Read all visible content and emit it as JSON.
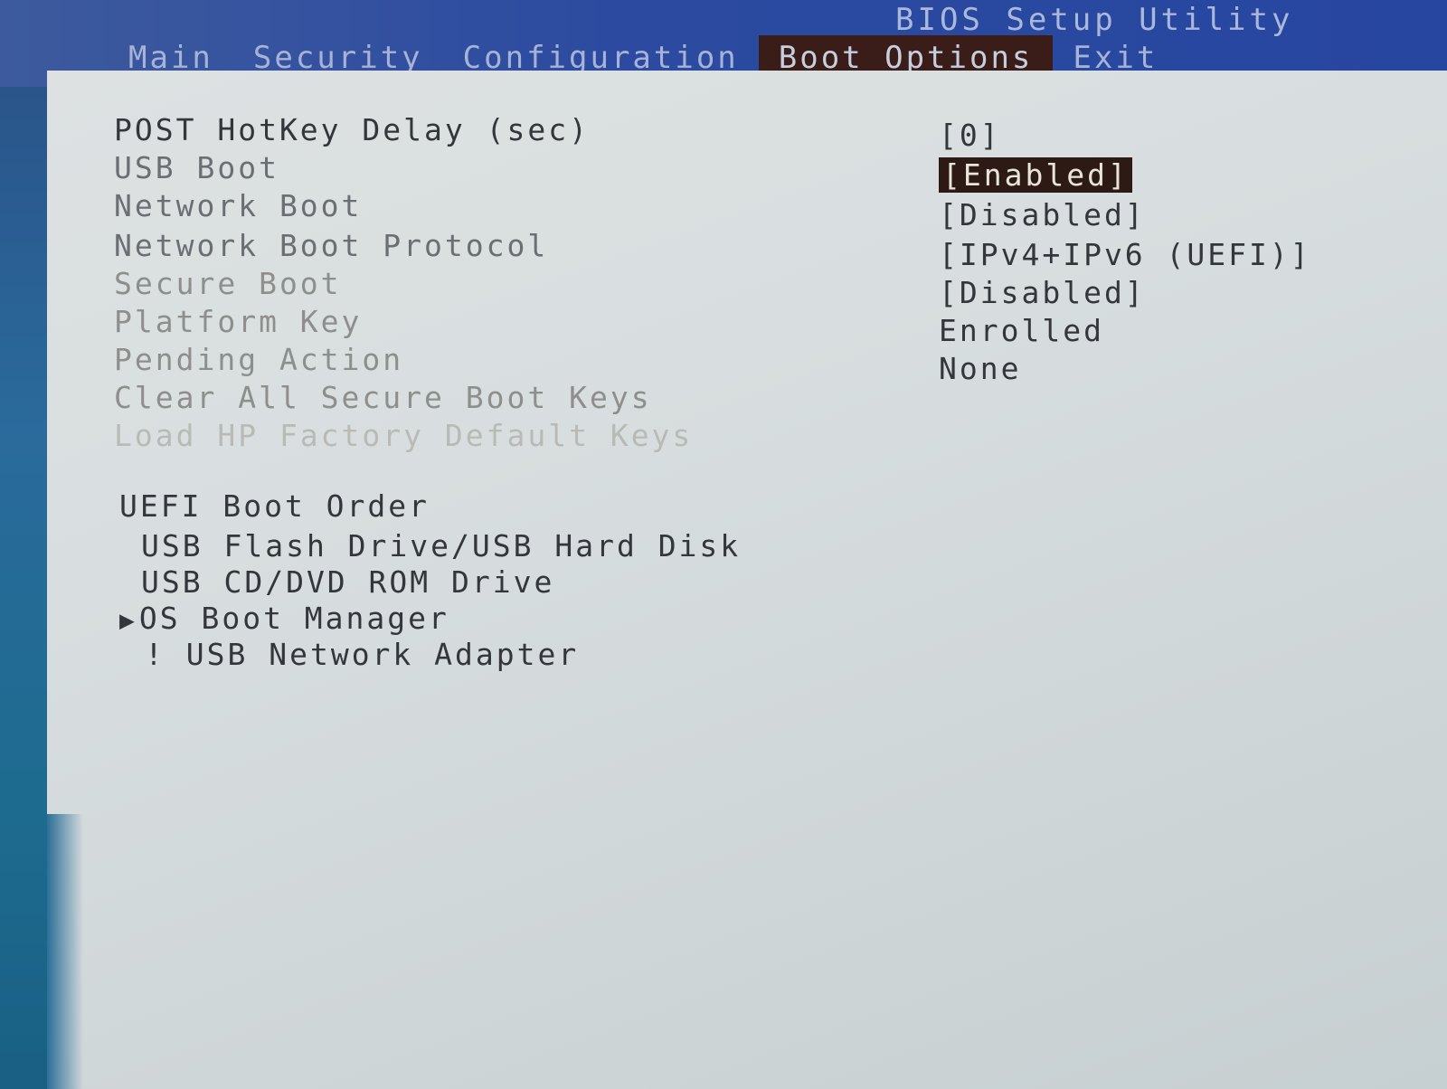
{
  "title": "BIOS Setup Utility",
  "tabs": [
    {
      "label": "Main"
    },
    {
      "label": "Security"
    },
    {
      "label": "Configuration"
    },
    {
      "label": "Boot Options"
    },
    {
      "label": "Exit"
    }
  ],
  "active_tab": "Boot Options",
  "settings": [
    {
      "label": "POST HotKey Delay (sec)",
      "value": "[0]"
    },
    {
      "label": "USB Boot",
      "value": "[Enabled]",
      "selected": true
    },
    {
      "label": "Network Boot",
      "value": "[Disabled]"
    },
    {
      "label": "Network Boot Protocol",
      "value": "[IPv4+IPv6 (UEFI)]"
    },
    {
      "label": "Secure Boot",
      "value": "[Disabled]"
    },
    {
      "label": "Platform Key",
      "value": "Enrolled"
    },
    {
      "label": "Pending Action",
      "value": "None"
    },
    {
      "label": "Clear All Secure Boot Keys"
    },
    {
      "label": "Load HP Factory Default Keys"
    }
  ],
  "boot_order": {
    "heading": "UEFI Boot Order",
    "items": [
      {
        "label": "USB Flash Drive/USB Hard Disk"
      },
      {
        "label": "USB CD/DVD ROM Drive"
      },
      {
        "label": "OS Boot Manager",
        "marker": "▶"
      },
      {
        "label": "USB Network Adapter",
        "marker": "!"
      }
    ]
  }
}
